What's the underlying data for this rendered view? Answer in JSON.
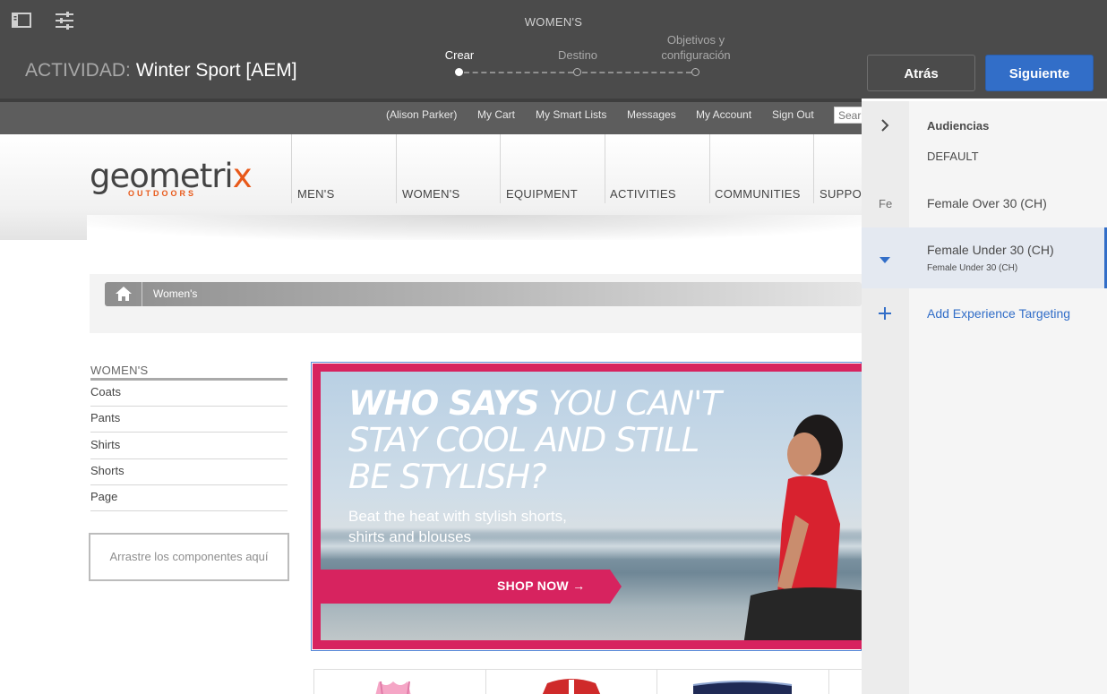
{
  "editor": {
    "page_title": "WOMEN'S",
    "activity_label": "ACTIVIDAD:",
    "activity_name": "Winter Sport [AEM]",
    "steps": [
      {
        "label": "Crear",
        "state": "active"
      },
      {
        "label": "Destino",
        "state": "pending"
      },
      {
        "label": "Objetivos y configuración",
        "state": "pending"
      }
    ],
    "back_label": "Atrás",
    "next_label": "Siguiente",
    "icons": {
      "sidepanel": "sidepanel-toggle-icon",
      "properties": "properties-sliders-icon"
    }
  },
  "site": {
    "util_links": [
      "(Alison Parker)",
      "My Cart",
      "My Smart Lists",
      "Messages",
      "My Account",
      "Sign Out"
    ],
    "search_placeholder": "Sear",
    "logo": {
      "main": "geometrix",
      "sub": "OUTDOORS"
    },
    "nav": [
      "MEN'S",
      "WOMEN'S",
      "EQUIPMENT",
      "ACTIVITIES",
      "COMMUNITIES",
      "SUPPO"
    ],
    "breadcrumb": "Women's",
    "sidebar_title": "WOMEN'S",
    "sidebar_items": [
      "Coats",
      "Pants",
      "Shirts",
      "Shorts",
      "Page"
    ],
    "dropzone": "Arrastre los componentes aquí",
    "hero": {
      "line1_bold": "WHO SAYS",
      "line1_rest": " YOU CAN'T",
      "line2": "STAY COOL AND STILL",
      "line3": "BE STYLISH?",
      "sub1": "Beat the heat with stylish shorts,",
      "sub2": "shirts and blouses",
      "cta": "SHOP NOW →"
    },
    "colors": {
      "accent": "#e8591a",
      "banner_frame": "#d7235f",
      "primary_button": "#326ec8"
    }
  },
  "panel": {
    "title": "Audiencias",
    "default_label": "DEFAULT",
    "audiences": [
      {
        "abbr": "Fe",
        "name": "Female Over 30 (CH)",
        "sub": ""
      },
      {
        "abbr": "",
        "name": "Female Under 30 (CH)",
        "sub": "Female Under 30 (CH)"
      }
    ],
    "add_label": "Add Experience Targeting"
  }
}
